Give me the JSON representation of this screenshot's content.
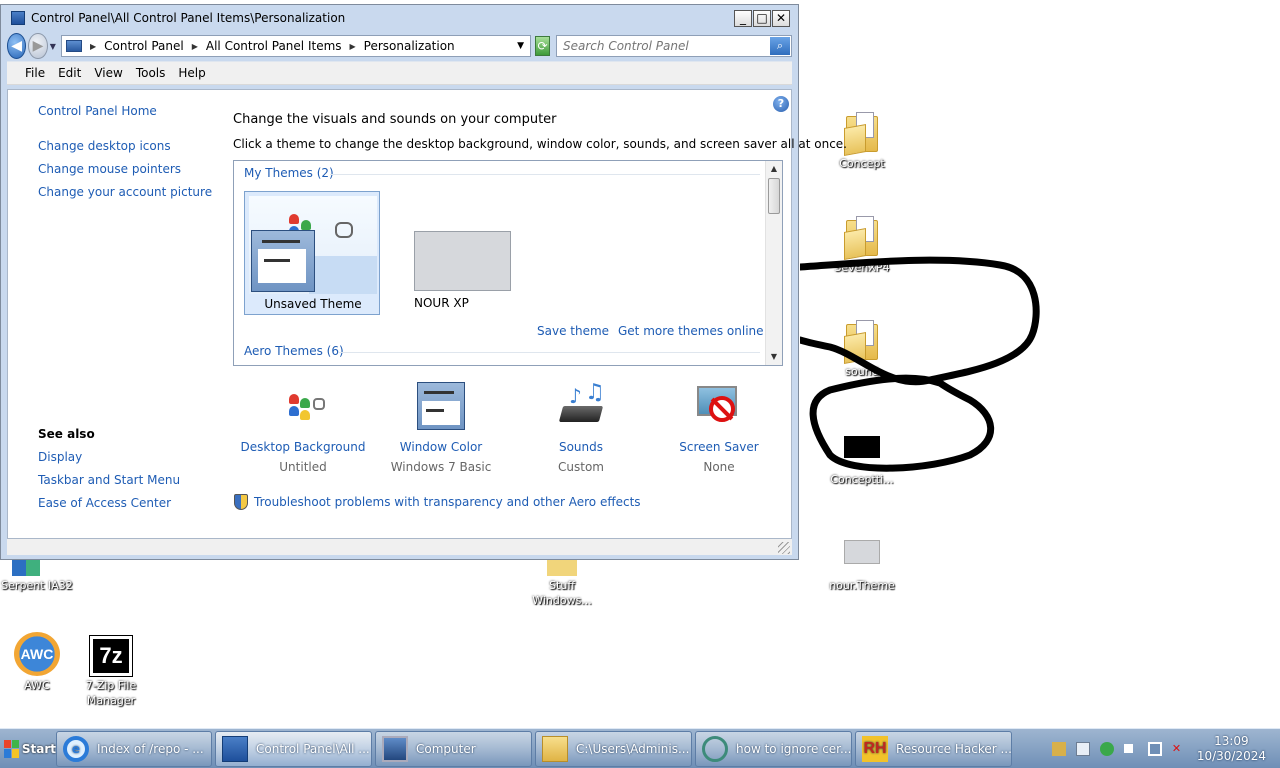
{
  "window": {
    "title": "Control Panel\\All Control Panel Items\\Personalization",
    "minimize": "_",
    "maximize": "□",
    "close": "✕"
  },
  "address": {
    "crumbs": [
      "Control Panel",
      "All Control Panel Items",
      "Personalization"
    ],
    "search_placeholder": "Search Control Panel"
  },
  "menu": [
    "File",
    "Edit",
    "View",
    "Tools",
    "Help"
  ],
  "left_pane": {
    "home": "Control Panel Home",
    "links": [
      "Change desktop icons",
      "Change mouse pointers",
      "Change your account picture"
    ],
    "see_also_title": "See also",
    "see_also": [
      "Display",
      "Taskbar and Start Menu",
      "Ease of Access Center"
    ]
  },
  "main": {
    "heading": "Change the visuals and sounds on your computer",
    "subheading": "Click a theme to change the desktop background, window color, sounds, and screen saver all at once.",
    "my_themes_label": "My Themes (2)",
    "themes": [
      "Unsaved Theme",
      "NOUR XP"
    ],
    "save_theme": "Save theme",
    "get_more": "Get more themes online",
    "aero_themes_label": "Aero Themes (6)",
    "options": [
      {
        "label": "Desktop Background",
        "sub": "Untitled"
      },
      {
        "label": "Window Color",
        "sub": "Windows 7 Basic"
      },
      {
        "label": "Sounds",
        "sub": "Custom"
      },
      {
        "label": "Screen Saver",
        "sub": "None"
      }
    ],
    "troubleshoot": "Troubleshoot problems with transparency and other Aero effects",
    "help_glyph": "?"
  },
  "desktop_icons": [
    "Concept",
    "SevenXP4",
    "sound",
    "Conceptti...",
    "nour.Theme",
    "Serpent IA32",
    "Stuff Windows...",
    "AWC",
    "7-Zip File Manager"
  ],
  "taskbar": {
    "start": "Start",
    "items": [
      "Index of /repo - ...",
      "Control Panel\\All ...",
      "Computer",
      "C:\\Users\\Adminis...",
      "how to ignore cer...",
      "Resource Hacker ..."
    ],
    "time": "13:09",
    "date": "10/30/2024"
  },
  "colors": {
    "link": "#1e5cb4",
    "window_frame": "#c9d9ee",
    "taskbar": "#7f9cc0"
  }
}
